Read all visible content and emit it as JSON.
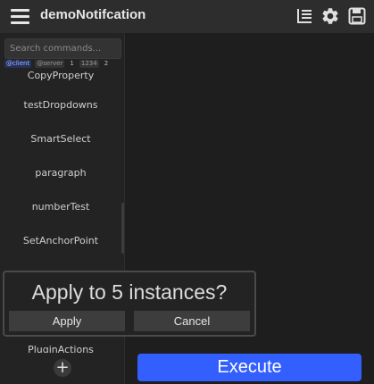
{
  "header": {
    "title": "demoNotifcation",
    "icons": [
      "menu-icon",
      "list-icon",
      "gear-icon",
      "save-icon"
    ]
  },
  "sidebar": {
    "search_placeholder": "Search commands...",
    "tags": [
      "@client",
      "@server",
      "1",
      "1234",
      "2"
    ],
    "items": [
      "CopyProperty",
      "testDropdowns",
      "SmartSelect",
      "paragraph",
      "numberTest",
      "SetAnchorPoint",
      "PluginActions"
    ],
    "add_label": "+"
  },
  "dialog": {
    "message": "Apply to 5 instances?",
    "apply_label": "Apply",
    "cancel_label": "Cancel"
  },
  "main": {
    "execute_label": "Execute"
  },
  "colors": {
    "accent": "#335fff",
    "background": "#1e1e1e",
    "header": "#2d2d2d"
  }
}
